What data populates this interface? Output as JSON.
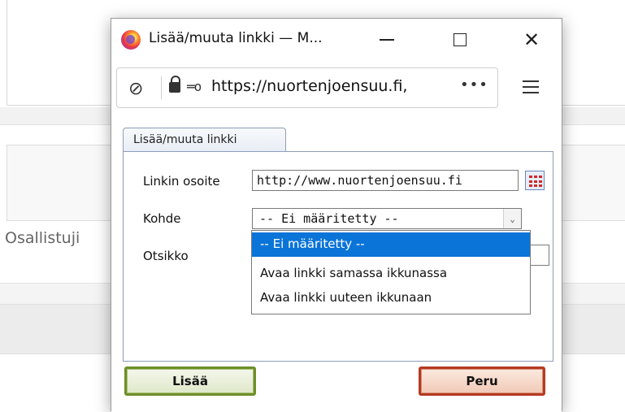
{
  "background": {
    "partial_text": "Osallistuji"
  },
  "window": {
    "title": "Lisää/muuta linkki — M...",
    "url": "https://nuortenjoensuu.fi,",
    "more_glyph": "•••",
    "permissions_glyph": "═o"
  },
  "dialog": {
    "tab_label": "Lisää/muuta linkki",
    "fields": {
      "url_label": "Linkin osoite",
      "url_value": "http://www.nuortenjoensuu.fi",
      "target_label": "Kohde",
      "target_value": "-- Ei määritetty --",
      "title_label": "Otsikko",
      "title_value": ""
    },
    "target_options": [
      "-- Ei määritetty --",
      "Avaa linkki samassa ikkunassa",
      "Avaa linkki uuteen ikkunaan"
    ],
    "selected_option_index": 0,
    "add_button": "Lisää",
    "cancel_button": "Peru"
  },
  "colors": {
    "selection": "#0a74d8",
    "add_border": "#6e8f2a",
    "cancel_border": "#b43a22",
    "tab_border": "#8f9db5"
  }
}
